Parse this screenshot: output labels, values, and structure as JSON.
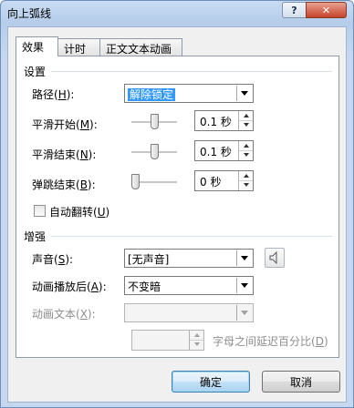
{
  "window": {
    "title": "向上弧线",
    "help_label": "?",
    "close_label": "✕"
  },
  "tabs": [
    {
      "label": "效果",
      "active": true
    },
    {
      "label": "计时",
      "active": false
    },
    {
      "label": "正文文本动画",
      "active": false
    }
  ],
  "settings": {
    "group_title": "设置",
    "path": {
      "label": "路径(",
      "key": "H",
      "suffix": "):",
      "value": "解除锁定"
    },
    "smooth_start": {
      "label": "平滑开始(",
      "key": "M",
      "suffix": "):",
      "value": "0.1 秒",
      "slider_fraction": 0.52
    },
    "smooth_end": {
      "label": "平滑结束(",
      "key": "N",
      "suffix": "):",
      "value": "0.1 秒",
      "slider_fraction": 0.52
    },
    "bounce_end": {
      "label": "弹跳结束(",
      "key": "B",
      "suffix": "):",
      "value": "0 秒",
      "slider_fraction": 0.0
    },
    "auto_reverse": {
      "label": "自动翻转(",
      "key": "U",
      "suffix": ")",
      "checked": false
    }
  },
  "enhancements": {
    "group_title": "增强",
    "sound": {
      "label": "声音(",
      "key": "S",
      "suffix": "):",
      "value": "[无声音]",
      "icon": "speaker-icon"
    },
    "after_animation": {
      "label": "动画播放后(",
      "key": "A",
      "suffix": "):",
      "value": "不变暗"
    },
    "animate_text": {
      "label": "动画文本(",
      "key": "X",
      "suffix": "):",
      "value": "",
      "disabled": true
    },
    "delay_spin": {
      "value": "",
      "disabled": true
    },
    "delay_label": {
      "label": "字母之间延迟百分比(",
      "key": "D",
      "suffix": ")",
      "disabled": true
    }
  },
  "buttons": {
    "ok": "确定",
    "cancel": "取消"
  },
  "colors": {
    "selection": "#3399ff",
    "title_gradient": "#b5cdea",
    "close_button": "#c7442c"
  }
}
